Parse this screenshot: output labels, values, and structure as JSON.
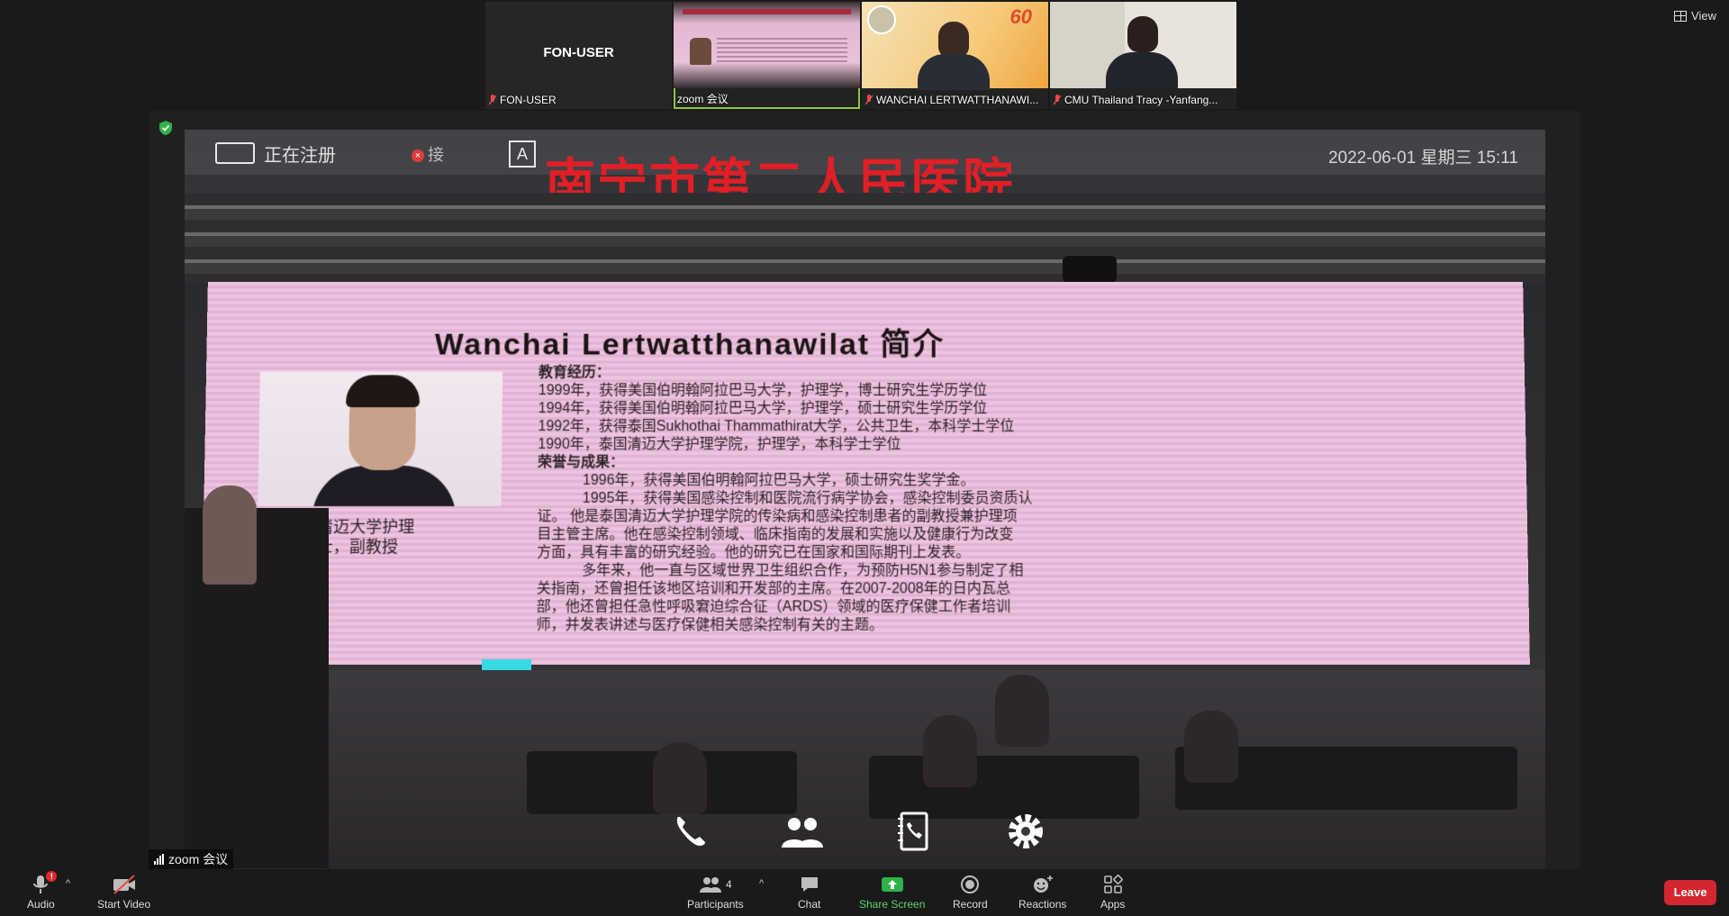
{
  "window": {
    "view_label": "View"
  },
  "thumbnails": [
    {
      "center_name": "FON-USER",
      "label": "FON-USER"
    },
    {
      "label": "zoom 会议"
    },
    {
      "label": "WANCHAI LERTWATTHANAWI..."
    },
    {
      "label": "CMU Thailand Tracy -Yanfang..."
    }
  ],
  "thumb2_logo": "60",
  "main": {
    "topbar_text": "正在注册",
    "topbar_text2": "接",
    "topbar_a": "A",
    "hospital": "南宁市第二人民医院",
    "datetime": "2022-06-01 星期三 15:11",
    "slide_title": "Wanchai Lertwatthanawilat 简介",
    "portrait_caption_1": "泰国清迈大学护理",
    "portrait_caption_2": "院博士，副教授",
    "edu_heading": "教育经历：",
    "edu": [
      "1999年，获得美国伯明翰阿拉巴马大学，护理学，博士研究生学历学位",
      "1994年，获得美国伯明翰阿拉巴马大学，护理学，硕士研究生学历学位",
      "1992年，获得泰国Sukhothai Thammathirat大学，公共卫生，本科学士学位",
      "1990年，泰国清迈大学护理学院，护理学，本科学士学位"
    ],
    "honor_heading": "荣誉与成果：",
    "honors": [
      "1996年，获得美国伯明翰阿拉巴马大学，硕士研究生奖学金。",
      "1995年，获得美国感染控制和医院流行病学协会，感染控制委员资质认"
    ],
    "bio": [
      "证。 他是泰国清迈大学护理学院的传染病和感染控制患者的副教授兼护理项",
      "目主管主席。他在感染控制领域、临床指南的发展和实施以及健康行为改变",
      "方面，具有丰富的研究经验。他的研究已在国家和国际期刊上发表。",
      "多年来，他一直与区域世界卫生组织合作，为预防H5N1参与制定了相",
      "关指南，还曾担任该地区培训和开发部的主席。在2007-2008年的日内瓦总",
      "部，他还曾担任急性呼吸窘迫综合征（ARDS）领域的医疗保健工作者培训",
      "师，并发表讲述与医疗保健相关感染控制有关的主题。"
    ],
    "source_tag": "zoom 会议"
  },
  "toolbar": {
    "audio": "Audio",
    "audio_badge": "!",
    "video": "Start Video",
    "participants": "Participants",
    "participants_count": "4",
    "chat": "Chat",
    "share": "Share Screen",
    "record": "Record",
    "reactions": "Reactions",
    "apps": "Apps",
    "leave": "Leave"
  },
  "colors": {
    "accent_green": "#5ad66c",
    "leave_red": "#d3262e",
    "active_border": "#8ec63f"
  }
}
